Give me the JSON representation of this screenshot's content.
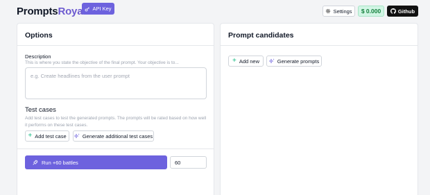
{
  "header": {
    "logo_main": "Prompts",
    "logo_accent": "Royale",
    "api_key_label": "API Key",
    "settings_label": "Settings",
    "balance": "$ 0.000",
    "github_label": "Github"
  },
  "options": {
    "title": "Options",
    "description_label": "Description",
    "description_help": "This is where you state the objective of the final prompt. Your objective is to...",
    "description_placeholder": "e.g. Create headlines from the user prompt",
    "test_cases_title": "Test cases",
    "test_cases_help": "Add test cases to test the generated prompts. The prompts will be rated based on how well it performs on these test cases.",
    "add_test_case_label": "Add test case",
    "generate_test_cases_label": "Generate additional test cases",
    "run_label": "Run +60 battles",
    "battles_value": "60"
  },
  "candidates": {
    "title": "Prompt candidates",
    "add_new_label": "Add new",
    "generate_prompts_label": "Generate prompts"
  },
  "colors": {
    "accent": "#6d62de",
    "balance_bg": "#d1f5e4",
    "balance_text": "#15803d",
    "plus": "#10b981"
  },
  "icons": [
    "key-icon",
    "gear-icon",
    "github-icon",
    "plus-icon",
    "sparkles-icon",
    "rocket-icon"
  ]
}
